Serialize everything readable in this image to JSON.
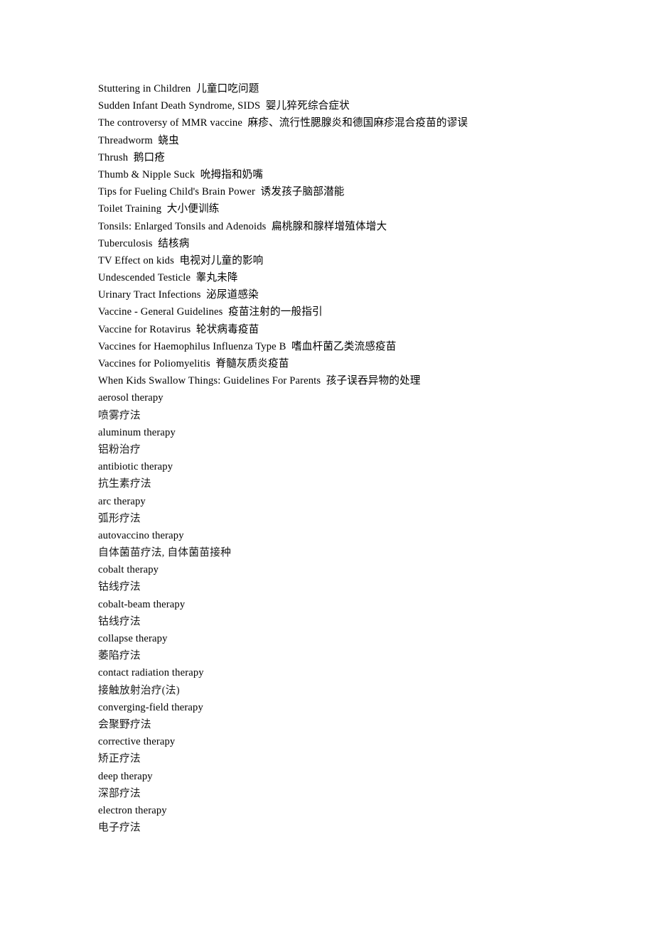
{
  "document": {
    "page_background": "#ffffff",
    "text_color": "#000000",
    "lines": [
      {
        "text": "Stuttering in Children  儿童口吃问题",
        "script": "mixed"
      },
      {
        "text": "Sudden Infant Death Syndrome, SIDS  婴儿猝死综合症状",
        "script": "mixed"
      },
      {
        "text": "The controversy of MMR vaccine  麻疹、流行性腮腺炎和德国麻疹混合疫苗的谬误",
        "script": "mixed"
      },
      {
        "text": "Threadworm  蛲虫",
        "script": "mixed"
      },
      {
        "text": "Thrush  鹅口疮",
        "script": "mixed"
      },
      {
        "text": "Thumb & Nipple Suck  吮拇指和奶嘴",
        "script": "mixed"
      },
      {
        "text": "Tips for Fueling Child's Brain Power  诱发孩子脑部潜能",
        "script": "mixed"
      },
      {
        "text": "Toilet Training  大小便训练",
        "script": "mixed"
      },
      {
        "text": "Tonsils: Enlarged Tonsils and Adenoids  扁桃腺和腺样增殖体增大",
        "script": "mixed"
      },
      {
        "text": "Tuberculosis  结核病",
        "script": "mixed"
      },
      {
        "text": "TV Effect on kids  电视对儿童的影响",
        "script": "mixed"
      },
      {
        "text": "Undescended Testicle  睾丸未降",
        "script": "mixed"
      },
      {
        "text": "Urinary Tract Infections  泌尿道感染",
        "script": "mixed"
      },
      {
        "text": "Vaccine - General Guidelines  疫苗注射的一般指引",
        "script": "mixed"
      },
      {
        "text": "Vaccine for Rotavirus  轮状病毒疫苗",
        "script": "mixed"
      },
      {
        "text": "Vaccines for Haemophilus Influenza Type B  嗜血杆菌乙类流感疫苗",
        "script": "mixed"
      },
      {
        "text": "Vaccines for Poliomyelitis  脊髓灰质炎疫苗",
        "script": "mixed"
      },
      {
        "text": "When Kids Swallow Things: Guidelines For Parents  孩子误吞异物的处理",
        "script": "mixed"
      },
      {
        "text": "aerosol therapy",
        "script": "latin"
      },
      {
        "text": "喷雾疗法",
        "script": "cjk"
      },
      {
        "text": "aluminum therapy",
        "script": "latin"
      },
      {
        "text": "铝粉治疗",
        "script": "cjk"
      },
      {
        "text": "antibiotic therapy",
        "script": "latin"
      },
      {
        "text": "抗生素疗法",
        "script": "cjk"
      },
      {
        "text": "arc therapy",
        "script": "latin"
      },
      {
        "text": "弧形疗法",
        "script": "cjk"
      },
      {
        "text": "autovaccino therapy",
        "script": "latin"
      },
      {
        "text": "自体菌苗疗法, 自体菌苗接种",
        "script": "cjk"
      },
      {
        "text": "cobalt therapy",
        "script": "latin"
      },
      {
        "text": "钴线疗法",
        "script": "cjk"
      },
      {
        "text": "cobalt-beam therapy",
        "script": "latin"
      },
      {
        "text": "钴线疗法",
        "script": "cjk"
      },
      {
        "text": "collapse therapy",
        "script": "latin"
      },
      {
        "text": "萎陷疗法",
        "script": "cjk"
      },
      {
        "text": "contact radiation therapy",
        "script": "latin"
      },
      {
        "text": "接触放射治疗(法)",
        "script": "cjk"
      },
      {
        "text": "converging-field therapy",
        "script": "latin"
      },
      {
        "text": "会聚野疗法",
        "script": "cjk"
      },
      {
        "text": "corrective therapy",
        "script": "latin"
      },
      {
        "text": "矫正疗法",
        "script": "cjk"
      },
      {
        "text": "deep therapy",
        "script": "latin"
      },
      {
        "text": "深部疗法",
        "script": "cjk"
      },
      {
        "text": "electron therapy",
        "script": "latin"
      },
      {
        "text": "电子疗法",
        "script": "cjk"
      }
    ]
  }
}
